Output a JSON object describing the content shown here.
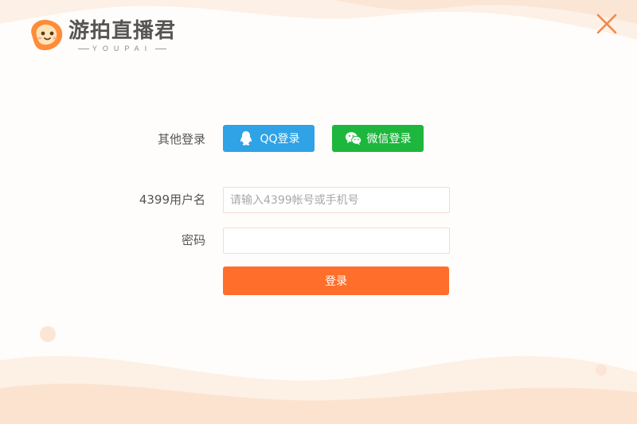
{
  "brand": {
    "name": "游拍直播君",
    "subtitle": "YOUPAI",
    "accent_color": "#ff6e2a"
  },
  "window": {
    "close_icon": "close-x-icon"
  },
  "social_login": {
    "label": "其他登录",
    "qq_button": {
      "label": "QQ登录",
      "icon": "qq-penguin-icon",
      "color": "#2fa3e6"
    },
    "wechat_button": {
      "label": "微信登录",
      "icon": "wechat-icon",
      "color": "#1eb73d"
    }
  },
  "form": {
    "username": {
      "label": "4399用户名",
      "placeholder": "请输入4399帐号或手机号",
      "value": ""
    },
    "password": {
      "label": "密码",
      "placeholder": "",
      "value": ""
    },
    "submit_label": "登录"
  }
}
